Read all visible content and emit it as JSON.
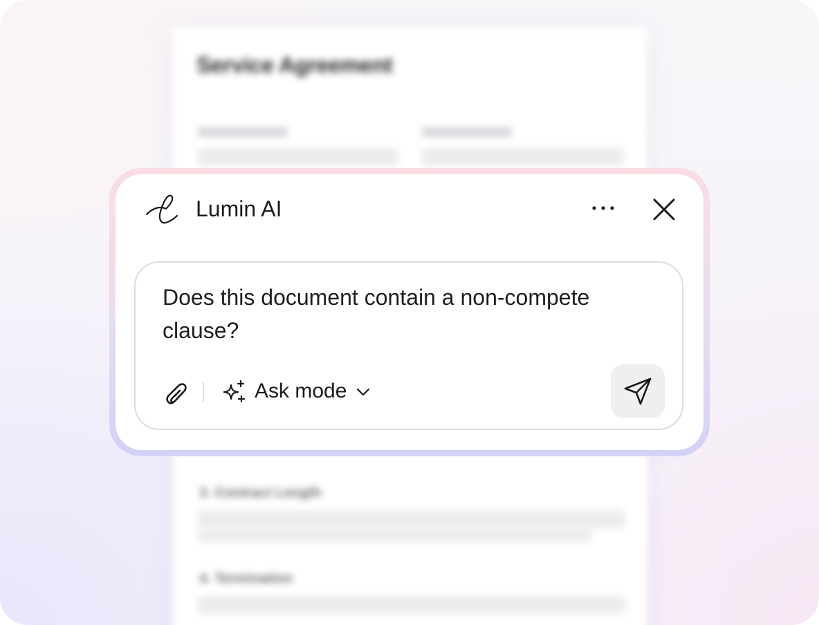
{
  "background_document": {
    "title": "Service Agreement",
    "section_3": "3. Contract Length",
    "section_4": "4. Termination"
  },
  "chat_panel": {
    "title": "Lumin AI",
    "logo_icon": "lumin-script-l-icon",
    "more_icon": "more-horizontal-icon",
    "close_icon": "close-icon",
    "prompt": {
      "value": "Does this document contain a non-compete clause?"
    },
    "toolbar": {
      "attach_icon": "paperclip-icon",
      "mode_icon": "sparkles-icon",
      "mode_label": "Ask mode",
      "mode_chevron_icon": "chevron-down-icon",
      "send_icon": "send-icon"
    }
  },
  "colors": {
    "card_glow_top": "#fbdde4",
    "card_glow_bottom": "#d3d1f7",
    "send_button_bg": "#efeff1",
    "text": "#1c1c1c"
  }
}
